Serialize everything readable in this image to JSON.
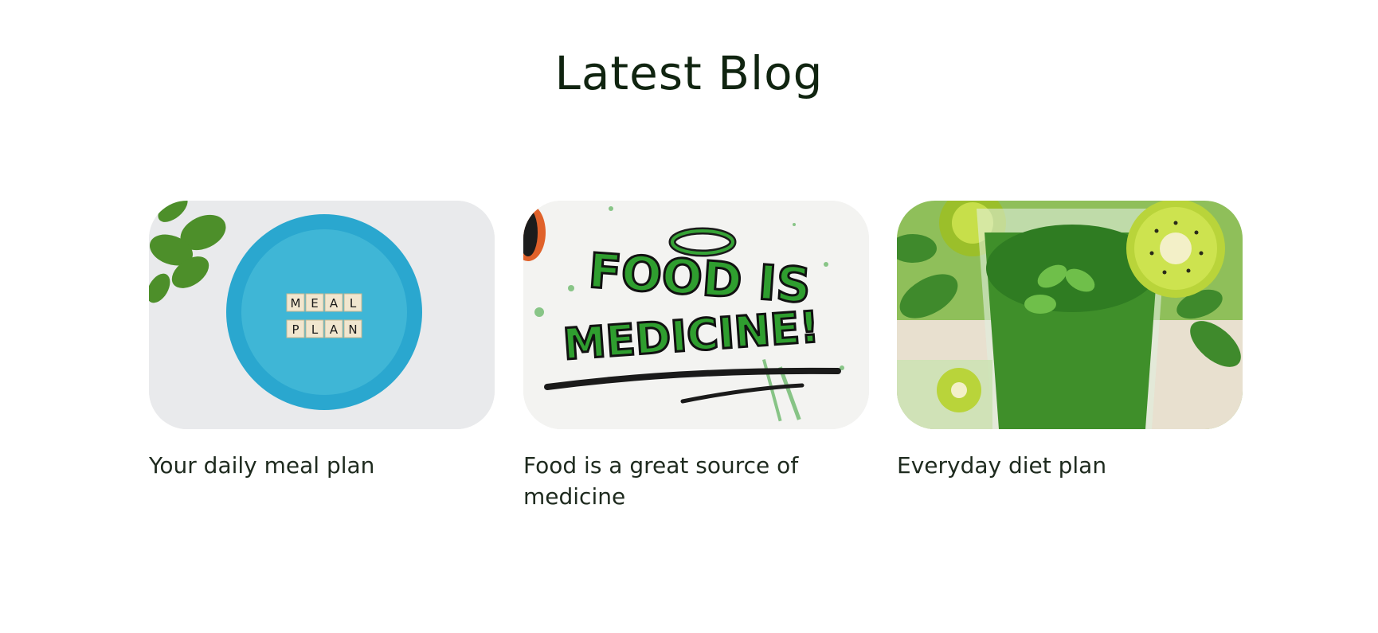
{
  "section": {
    "title": "Latest Blog"
  },
  "posts": [
    {
      "title": "Your daily meal plan",
      "image": {
        "tiles_row1": [
          "M",
          "E",
          "A",
          "L"
        ],
        "tiles_row2": [
          "P",
          "L",
          "A",
          "N"
        ],
        "plate_color": "#3fb6d6"
      }
    },
    {
      "title": "Food is a great source of medicine",
      "image": {
        "line1": "FOOD IS",
        "line2": "MEDICINE!",
        "paint_color": "#2f9e2f"
      }
    },
    {
      "title": "Everyday diet plan",
      "image": {
        "smoothie_color": "#3f8f2a",
        "kiwi_color": "#b9d43a"
      }
    }
  ]
}
